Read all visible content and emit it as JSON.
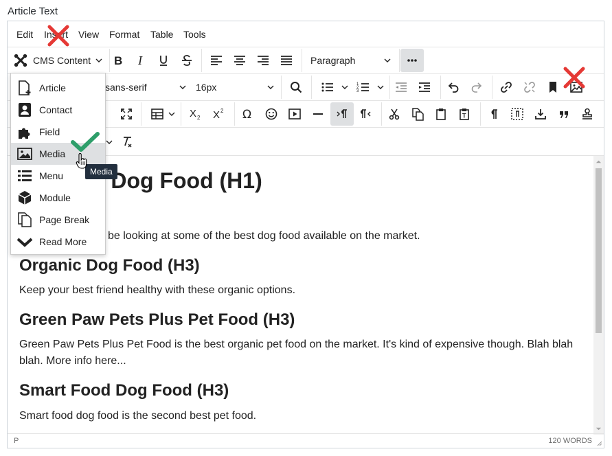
{
  "field_label": "Article Text",
  "menubar": [
    "Edit",
    "Insert",
    "View",
    "Format",
    "Table",
    "Tools"
  ],
  "toolbar1": {
    "cms_content_label": "CMS Content",
    "block_format_value": "Paragraph"
  },
  "toolbar2": {
    "font_family_value": "sans-serif",
    "font_size_value": "16px"
  },
  "dropdown_items": [
    {
      "label": "Article",
      "icon": "article-icon"
    },
    {
      "label": "Contact",
      "icon": "contact-icon"
    },
    {
      "label": "Field",
      "icon": "puzzle-icon"
    },
    {
      "label": "Media",
      "icon": "image-icon"
    },
    {
      "label": "Menu",
      "icon": "list-icon"
    },
    {
      "label": "Module",
      "icon": "cube-icon"
    },
    {
      "label": "Page Break",
      "icon": "page-break-icon"
    },
    {
      "label": "Read More",
      "icon": "chevron-down-icon"
    }
  ],
  "tooltip": "Media",
  "content": {
    "h1_visible": "st Dog Food (H1)",
    "intro_visible": "be looking at some of the best dog food available on the market.",
    "h3_1": "Organic Dog Food (H3)",
    "p_1": "Keep your best friend healthy with these organic options.",
    "h3_2": "Green Paw Pets Plus Pet Food (H3)",
    "p_2": "Green Paw Pets Plus Pet Food is the best organic pet food on the market. It's kind of expensive though. Blah blah blah. More info here...",
    "h3_3": "Smart Food Dog Food (H3)",
    "p_3": "Smart food dog food is the second best pet food."
  },
  "status": {
    "path": "P",
    "words": "120 WORDS"
  },
  "colors": {
    "red_x": "#e53935",
    "green_check": "#2e9e6a",
    "tooltip_bg": "#222f3e"
  }
}
